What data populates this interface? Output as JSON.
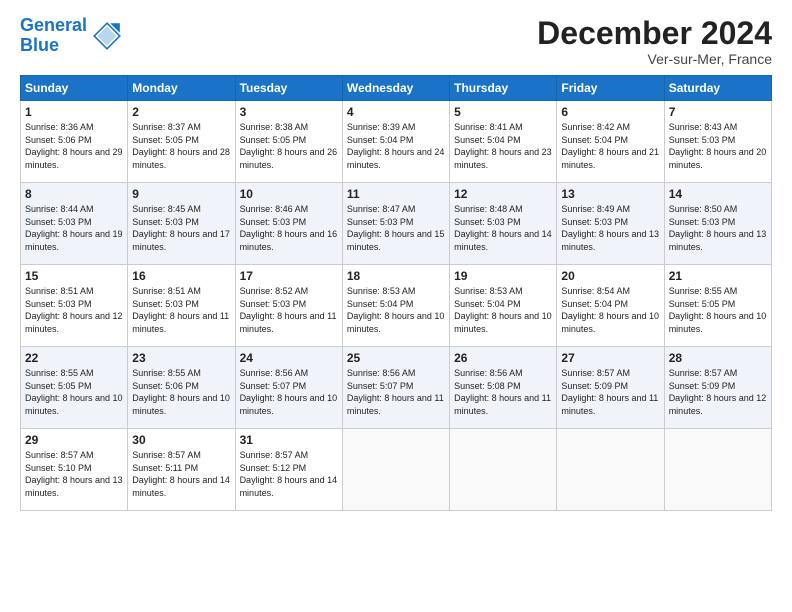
{
  "logo": {
    "line1": "General",
    "line2": "Blue"
  },
  "title": "December 2024",
  "location": "Ver-sur-Mer, France",
  "days_of_week": [
    "Sunday",
    "Monday",
    "Tuesday",
    "Wednesday",
    "Thursday",
    "Friday",
    "Saturday"
  ],
  "weeks": [
    [
      {
        "day": "1",
        "sunrise": "Sunrise: 8:36 AM",
        "sunset": "Sunset: 5:06 PM",
        "daylight": "Daylight: 8 hours and 29 minutes."
      },
      {
        "day": "2",
        "sunrise": "Sunrise: 8:37 AM",
        "sunset": "Sunset: 5:05 PM",
        "daylight": "Daylight: 8 hours and 28 minutes."
      },
      {
        "day": "3",
        "sunrise": "Sunrise: 8:38 AM",
        "sunset": "Sunset: 5:05 PM",
        "daylight": "Daylight: 8 hours and 26 minutes."
      },
      {
        "day": "4",
        "sunrise": "Sunrise: 8:39 AM",
        "sunset": "Sunset: 5:04 PM",
        "daylight": "Daylight: 8 hours and 24 minutes."
      },
      {
        "day": "5",
        "sunrise": "Sunrise: 8:41 AM",
        "sunset": "Sunset: 5:04 PM",
        "daylight": "Daylight: 8 hours and 23 minutes."
      },
      {
        "day": "6",
        "sunrise": "Sunrise: 8:42 AM",
        "sunset": "Sunset: 5:04 PM",
        "daylight": "Daylight: 8 hours and 21 minutes."
      },
      {
        "day": "7",
        "sunrise": "Sunrise: 8:43 AM",
        "sunset": "Sunset: 5:03 PM",
        "daylight": "Daylight: 8 hours and 20 minutes."
      }
    ],
    [
      {
        "day": "8",
        "sunrise": "Sunrise: 8:44 AM",
        "sunset": "Sunset: 5:03 PM",
        "daylight": "Daylight: 8 hours and 19 minutes."
      },
      {
        "day": "9",
        "sunrise": "Sunrise: 8:45 AM",
        "sunset": "Sunset: 5:03 PM",
        "daylight": "Daylight: 8 hours and 17 minutes."
      },
      {
        "day": "10",
        "sunrise": "Sunrise: 8:46 AM",
        "sunset": "Sunset: 5:03 PM",
        "daylight": "Daylight: 8 hours and 16 minutes."
      },
      {
        "day": "11",
        "sunrise": "Sunrise: 8:47 AM",
        "sunset": "Sunset: 5:03 PM",
        "daylight": "Daylight: 8 hours and 15 minutes."
      },
      {
        "day": "12",
        "sunrise": "Sunrise: 8:48 AM",
        "sunset": "Sunset: 5:03 PM",
        "daylight": "Daylight: 8 hours and 14 minutes."
      },
      {
        "day": "13",
        "sunrise": "Sunrise: 8:49 AM",
        "sunset": "Sunset: 5:03 PM",
        "daylight": "Daylight: 8 hours and 13 minutes."
      },
      {
        "day": "14",
        "sunrise": "Sunrise: 8:50 AM",
        "sunset": "Sunset: 5:03 PM",
        "daylight": "Daylight: 8 hours and 13 minutes."
      }
    ],
    [
      {
        "day": "15",
        "sunrise": "Sunrise: 8:51 AM",
        "sunset": "Sunset: 5:03 PM",
        "daylight": "Daylight: 8 hours and 12 minutes."
      },
      {
        "day": "16",
        "sunrise": "Sunrise: 8:51 AM",
        "sunset": "Sunset: 5:03 PM",
        "daylight": "Daylight: 8 hours and 11 minutes."
      },
      {
        "day": "17",
        "sunrise": "Sunrise: 8:52 AM",
        "sunset": "Sunset: 5:03 PM",
        "daylight": "Daylight: 8 hours and 11 minutes."
      },
      {
        "day": "18",
        "sunrise": "Sunrise: 8:53 AM",
        "sunset": "Sunset: 5:04 PM",
        "daylight": "Daylight: 8 hours and 10 minutes."
      },
      {
        "day": "19",
        "sunrise": "Sunrise: 8:53 AM",
        "sunset": "Sunset: 5:04 PM",
        "daylight": "Daylight: 8 hours and 10 minutes."
      },
      {
        "day": "20",
        "sunrise": "Sunrise: 8:54 AM",
        "sunset": "Sunset: 5:04 PM",
        "daylight": "Daylight: 8 hours and 10 minutes."
      },
      {
        "day": "21",
        "sunrise": "Sunrise: 8:55 AM",
        "sunset": "Sunset: 5:05 PM",
        "daylight": "Daylight: 8 hours and 10 minutes."
      }
    ],
    [
      {
        "day": "22",
        "sunrise": "Sunrise: 8:55 AM",
        "sunset": "Sunset: 5:05 PM",
        "daylight": "Daylight: 8 hours and 10 minutes."
      },
      {
        "day": "23",
        "sunrise": "Sunrise: 8:55 AM",
        "sunset": "Sunset: 5:06 PM",
        "daylight": "Daylight: 8 hours and 10 minutes."
      },
      {
        "day": "24",
        "sunrise": "Sunrise: 8:56 AM",
        "sunset": "Sunset: 5:07 PM",
        "daylight": "Daylight: 8 hours and 10 minutes."
      },
      {
        "day": "25",
        "sunrise": "Sunrise: 8:56 AM",
        "sunset": "Sunset: 5:07 PM",
        "daylight": "Daylight: 8 hours and 11 minutes."
      },
      {
        "day": "26",
        "sunrise": "Sunrise: 8:56 AM",
        "sunset": "Sunset: 5:08 PM",
        "daylight": "Daylight: 8 hours and 11 minutes."
      },
      {
        "day": "27",
        "sunrise": "Sunrise: 8:57 AM",
        "sunset": "Sunset: 5:09 PM",
        "daylight": "Daylight: 8 hours and 11 minutes."
      },
      {
        "day": "28",
        "sunrise": "Sunrise: 8:57 AM",
        "sunset": "Sunset: 5:09 PM",
        "daylight": "Daylight: 8 hours and 12 minutes."
      }
    ],
    [
      {
        "day": "29",
        "sunrise": "Sunrise: 8:57 AM",
        "sunset": "Sunset: 5:10 PM",
        "daylight": "Daylight: 8 hours and 13 minutes."
      },
      {
        "day": "30",
        "sunrise": "Sunrise: 8:57 AM",
        "sunset": "Sunset: 5:11 PM",
        "daylight": "Daylight: 8 hours and 14 minutes."
      },
      {
        "day": "31",
        "sunrise": "Sunrise: 8:57 AM",
        "sunset": "Sunset: 5:12 PM",
        "daylight": "Daylight: 8 hours and 14 minutes."
      },
      null,
      null,
      null,
      null
    ]
  ]
}
